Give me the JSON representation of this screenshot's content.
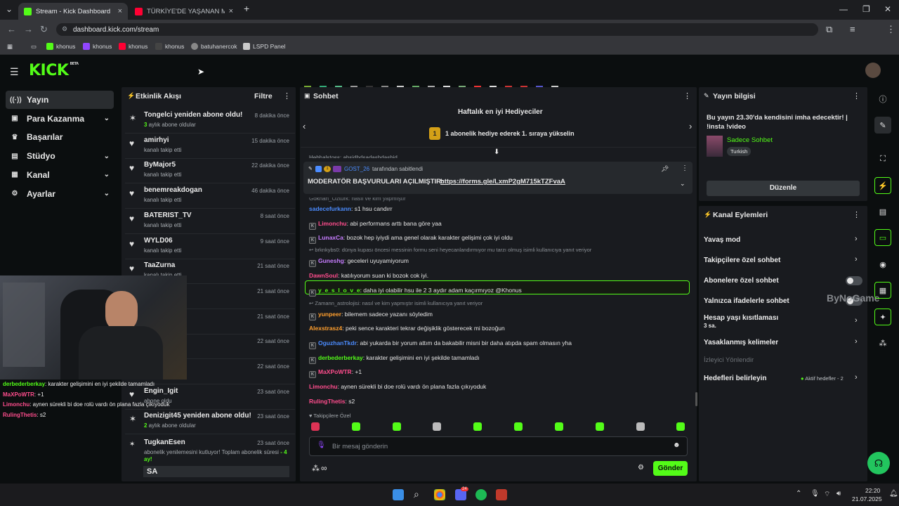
{
  "browser": {
    "tabs": [
      {
        "title": "Stream - Kick Dashboard",
        "active": true
      },
      {
        "title": "TÜRKİYE'DE YAŞANAN MOTOR...",
        "active": false
      }
    ],
    "url": "dashboard.kick.com/stream",
    "bookmarks": [
      {
        "label": "khonus",
        "icon": "kick-icon"
      },
      {
        "label": "khonus",
        "icon": "twitch-icon"
      },
      {
        "label": "khonus",
        "icon": "youtube-icon"
      },
      {
        "label": "khonus",
        "icon": "x-icon"
      },
      {
        "label": "batuhanercok",
        "icon": "github-icon"
      },
      {
        "label": "LSPD Panel",
        "icon": "shield-icon"
      }
    ]
  },
  "kick": {
    "logo": "KICK",
    "logo_tag": "BETA",
    "sidebar": [
      {
        "label": "Yayın",
        "icon": "stream-icon",
        "active": true,
        "expand": false
      },
      {
        "label": "Para Kazanma",
        "icon": "money-icon",
        "active": false,
        "expand": true
      },
      {
        "label": "Başarılar",
        "icon": "trophy-icon",
        "active": false,
        "expand": false
      },
      {
        "label": "Stüdyo",
        "icon": "studio-icon",
        "active": false,
        "expand": true
      },
      {
        "label": "Kanal",
        "icon": "channel-icon",
        "active": false,
        "expand": true
      },
      {
        "label": "Ayarlar",
        "icon": "gear-icon",
        "active": false,
        "expand": true
      }
    ]
  },
  "activity": {
    "title": "Etkinlik Akışı",
    "filter": "Filtre",
    "events": [
      {
        "title": "Tongelci yeniden abone oldu!",
        "sub_b": "3",
        "sub": " aylık abone oldular",
        "time": "8 dakika önce",
        "icon": "sparkle-icon"
      },
      {
        "title": "amirhyi",
        "sub_b": "",
        "sub": "kanalı takip etti",
        "time": "15 dakika önce",
        "icon": "heart-icon"
      },
      {
        "title": "ByMajor5",
        "sub_b": "",
        "sub": "kanalı takip etti",
        "time": "22 dakika önce",
        "icon": "heart-icon"
      },
      {
        "title": "benemreakdogan",
        "sub_b": "",
        "sub": "kanalı takip etti",
        "time": "46 dakika önce",
        "icon": "heart-icon"
      },
      {
        "title": "BATERIST_TV",
        "sub_b": "",
        "sub": "kanalı takip etti",
        "time": "8 saat önce",
        "icon": "heart-icon"
      },
      {
        "title": "WYLD06",
        "sub_b": "",
        "sub": "kanalı takip etti",
        "time": "9 saat önce",
        "icon": "heart-icon"
      },
      {
        "title": "TaaZurna",
        "sub_b": "",
        "sub": "kanalı takip etti",
        "time": "21 saat önce",
        "icon": "heart-icon"
      },
      {
        "title": "",
        "sub_b": "",
        "sub": "",
        "time": "21 saat önce",
        "icon": "heart-icon"
      },
      {
        "title": "",
        "sub_b": "",
        "sub": "",
        "time": "21 saat önce",
        "icon": "heart-icon"
      },
      {
        "title": "",
        "sub_b": "",
        "sub": "",
        "time": "22 saat önce",
        "icon": "heart-icon"
      },
      {
        "title": "",
        "sub_b": "",
        "sub": "",
        "time": "22 saat önce",
        "icon": "heart-icon"
      },
      {
        "title": "Engin_Igit",
        "sub_b": "",
        "sub": "abone oldu",
        "time": "23 saat önce",
        "icon": "heart-icon"
      },
      {
        "title": "Denizigit45 yeniden abone oldu!",
        "sub_b": "2",
        "sub": " aylık abone oldular",
        "time": "23 saat önce",
        "icon": "sparkle-icon"
      }
    ],
    "last_event": {
      "title": "TugkanEsen",
      "time": "23 saat önce",
      "text": "abonelik yenilemesini kutluyor! Toplam abonelik süresi",
      "months": "- 4 ay!",
      "message": "SA"
    }
  },
  "webcam_chat": [
    {
      "user": "derbederberkay",
      "text": ": karakter gelişimini en iyi şekilde tamamladı",
      "color": "#53fc18"
    },
    {
      "user": "MaXPoWTR",
      "text": ": +1",
      "color": "#ff4d8d"
    },
    {
      "user": "Limonchu",
      "text": ": aynen sürekli bi doe rolü vardı ön plana fazla çıkıyoduk",
      "color": "#ff4d8d"
    },
    {
      "user": "RulingThetis",
      "text": ": s2",
      "color": "#ff4d8d"
    }
  ],
  "chat": {
    "title": "Sohbet",
    "leaderboard_title": "Haftalık en iyi Hediyeciler",
    "leaderboard_rank": "1",
    "leaderboard_text": "1 abonelik hediye ederek 1. sıraya yükselin",
    "pinned_user": "GOST_26",
    "pinned_by": "tarafından sabitlendi",
    "pinned_badge_count": "1",
    "pinned_text": "MODERATÖR BAŞVURULARI AÇILMIŞTIR:",
    "pinned_link": "https://forms.gle/LxmP2gM715kTZFvaA",
    "partial_top": "Hebhalstoss: ahsidhdsadashdashid",
    "partial_mid": "Gokhan_Ozturk: nasıl ve kim yapmıştır",
    "messages": [
      {
        "user": "sadecefurkann",
        "text": ": s1 hsu candırr",
        "color": "#4b8cff",
        "badge": "",
        "reply": ""
      },
      {
        "user": "Limonchu",
        "text": ": abi performans arttı bana göre yaa",
        "color": "#ff4d8d",
        "badge": "K",
        "reply": ""
      },
      {
        "user": "LunaxCa",
        "text": ": bozok hep iyiydi ama genel olarak karakter gelişimi çok iyi oldu",
        "color": "#c77dff",
        "badge": "K",
        "reply": ""
      },
      {
        "user": "Guneshg",
        "text": ": geceleri uyuyamiyorum",
        "color": "#c77dff",
        "badge": "K",
        "reply": "brknkybs0: dünya kupası öncesi messinin formu seni heyecanlandırmıyor mu tarzı olmuş isimli kullanıcıya yanıt veriyor"
      },
      {
        "user": "DawnSoul",
        "text": ": katılıyorum suan ki bozok cok iyi.",
        "color": "#ff4d8d",
        "badge": "",
        "reply": ""
      },
      {
        "user": "y_e_s_l_o_v_e",
        "text": ": daha iyi olabilir hsu ile 2 3 aydır adam kaçırmıyoz @Khonus",
        "color": "#53fc18",
        "badge": "K",
        "reply": "",
        "highlight": true
      },
      {
        "user": "yunpeer",
        "text": ": bilemem sadece yazanı söyledim",
        "color": "#ff9f2e",
        "badge": "K",
        "reply": "Zamann_astrolojisi: nasıl ve kim yapmıştır isimli kullanıcıya yanıt veriyor"
      },
      {
        "user": "Alexstrasz4",
        "text": ": peki sence karakteri tekrar değişiklik gösterecek mi bozoğun",
        "color": "#ff9f2e",
        "badge": "",
        "reply": ""
      },
      {
        "user": "OguzhanTkdr",
        "text": ": abi yukarda bir yorum attım da bakabilir misni bir daha atıpda spam olmasın yha",
        "color": "#4b8cff",
        "badge": "K",
        "reply": ""
      },
      {
        "user": "derbederberkay",
        "text": ": karakter gelişimini en iyi şekilde tamamladı",
        "color": "#53fc18",
        "badge": "K",
        "reply": ""
      },
      {
        "user": "MaXPoWTR",
        "text": ": +1",
        "color": "#ff4d8d",
        "badge": "K",
        "reply": ""
      },
      {
        "user": "Limonchu",
        "text": ": aynen sürekli bi doe rolü vardı ön plana fazla çıkıyoduk",
        "color": "#ff4d8d",
        "badge": "",
        "reply": ""
      },
      {
        "user": "RulingThetis",
        "text": ": s2",
        "color": "#ff4d8d",
        "badge": "",
        "reply": ""
      }
    ],
    "followers_only": "Takipçilere Özel",
    "input_placeholder": "Bir mesaj gönderin",
    "send": "Gönder"
  },
  "stream_info": {
    "title": "Yayın bilgisi",
    "stream_title": "Bu yayın 23.30'da kendisini imha edecektir! | !insta !video",
    "category": "Sadece Sohbet",
    "tag": "Turkish",
    "edit": "Düzenle"
  },
  "channel_actions": {
    "title": "Kanal Eylemleri",
    "items": [
      {
        "label": "Yavaş mod",
        "sub": "",
        "control": "chevron"
      },
      {
        "label": "Takipçilere özel sohbet",
        "sub": "",
        "control": "chevron"
      },
      {
        "label": "Abonelere özel sohbet",
        "sub": "",
        "control": "toggle"
      },
      {
        "label": "Yalnızca ifadelerle sohbet",
        "sub": "",
        "control": "toggle"
      },
      {
        "label": "Hesap yaşı kısıtlaması",
        "sub": "3 sa.",
        "control": "chevron"
      },
      {
        "label": "Yasaklanmış kelimeler",
        "sub": "",
        "control": "chevron"
      }
    ],
    "viewer_section": "İzleyici Yönlendir",
    "goals_label": "Hedefleri belirleyin",
    "goals_status": "Aktif hedefler - 2"
  },
  "watermark": "ByNoGame",
  "taskbar": {
    "time": "22:20",
    "date": "21.07.2025",
    "discord_badge": "24"
  },
  "colors": {
    "accent": "#53fc18",
    "panel": "#191b1f",
    "bg": "#0b0e0f"
  }
}
